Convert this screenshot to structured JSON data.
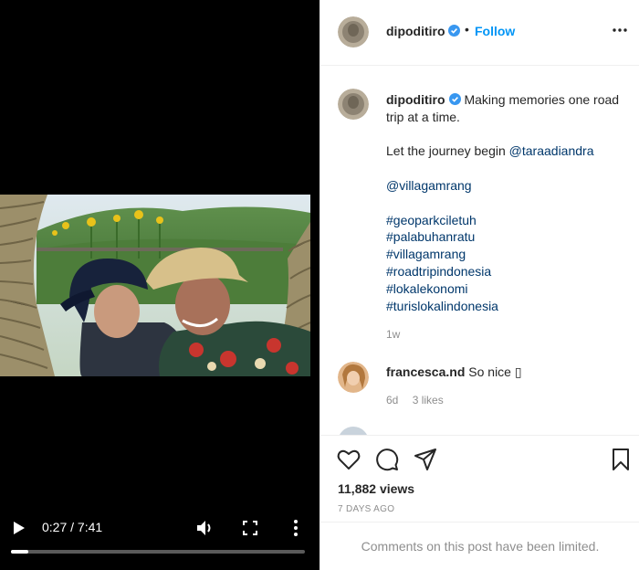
{
  "video": {
    "time_current": "0:27",
    "time_total": "7:41",
    "time_display": "0:27 / 7:41",
    "progress_fraction": 0.059
  },
  "post": {
    "username": "dipoditiro",
    "follow_label": "Follow",
    "dot": "•",
    "caption": {
      "text_line1": "Making memories one road trip at a time.",
      "text_line2": "Let the journey begin",
      "mention1": "@taraadiandra",
      "mention2": "@villagamrang",
      "hashtags": [
        "#geoparkciletuh",
        "#palabuhanratu",
        "#villagamrang",
        "#roadtripindonesia",
        "#lokalekonomi",
        "#turislokalindonesia"
      ],
      "time_ago": "1w"
    },
    "comments": [
      {
        "username": "francesca.nd",
        "text": "So nice ▯",
        "time_ago": "6d",
        "likes": "3 likes"
      }
    ],
    "views": "11,882 views",
    "date": "7 DAYS AGO",
    "comments_limited": "Comments on this post have been limited."
  },
  "colors": {
    "follow_blue": "#0095f6",
    "link_blue": "#00376b",
    "muted": "#8e8e8e",
    "verified_blue": "#3897f0"
  },
  "icons": [
    "play-icon",
    "volume-icon",
    "fullscreen-icon",
    "more-vertical-icon",
    "verified-icon",
    "more-horizontal-icon",
    "heart-icon",
    "comment-icon",
    "share-icon",
    "bookmark-icon"
  ]
}
